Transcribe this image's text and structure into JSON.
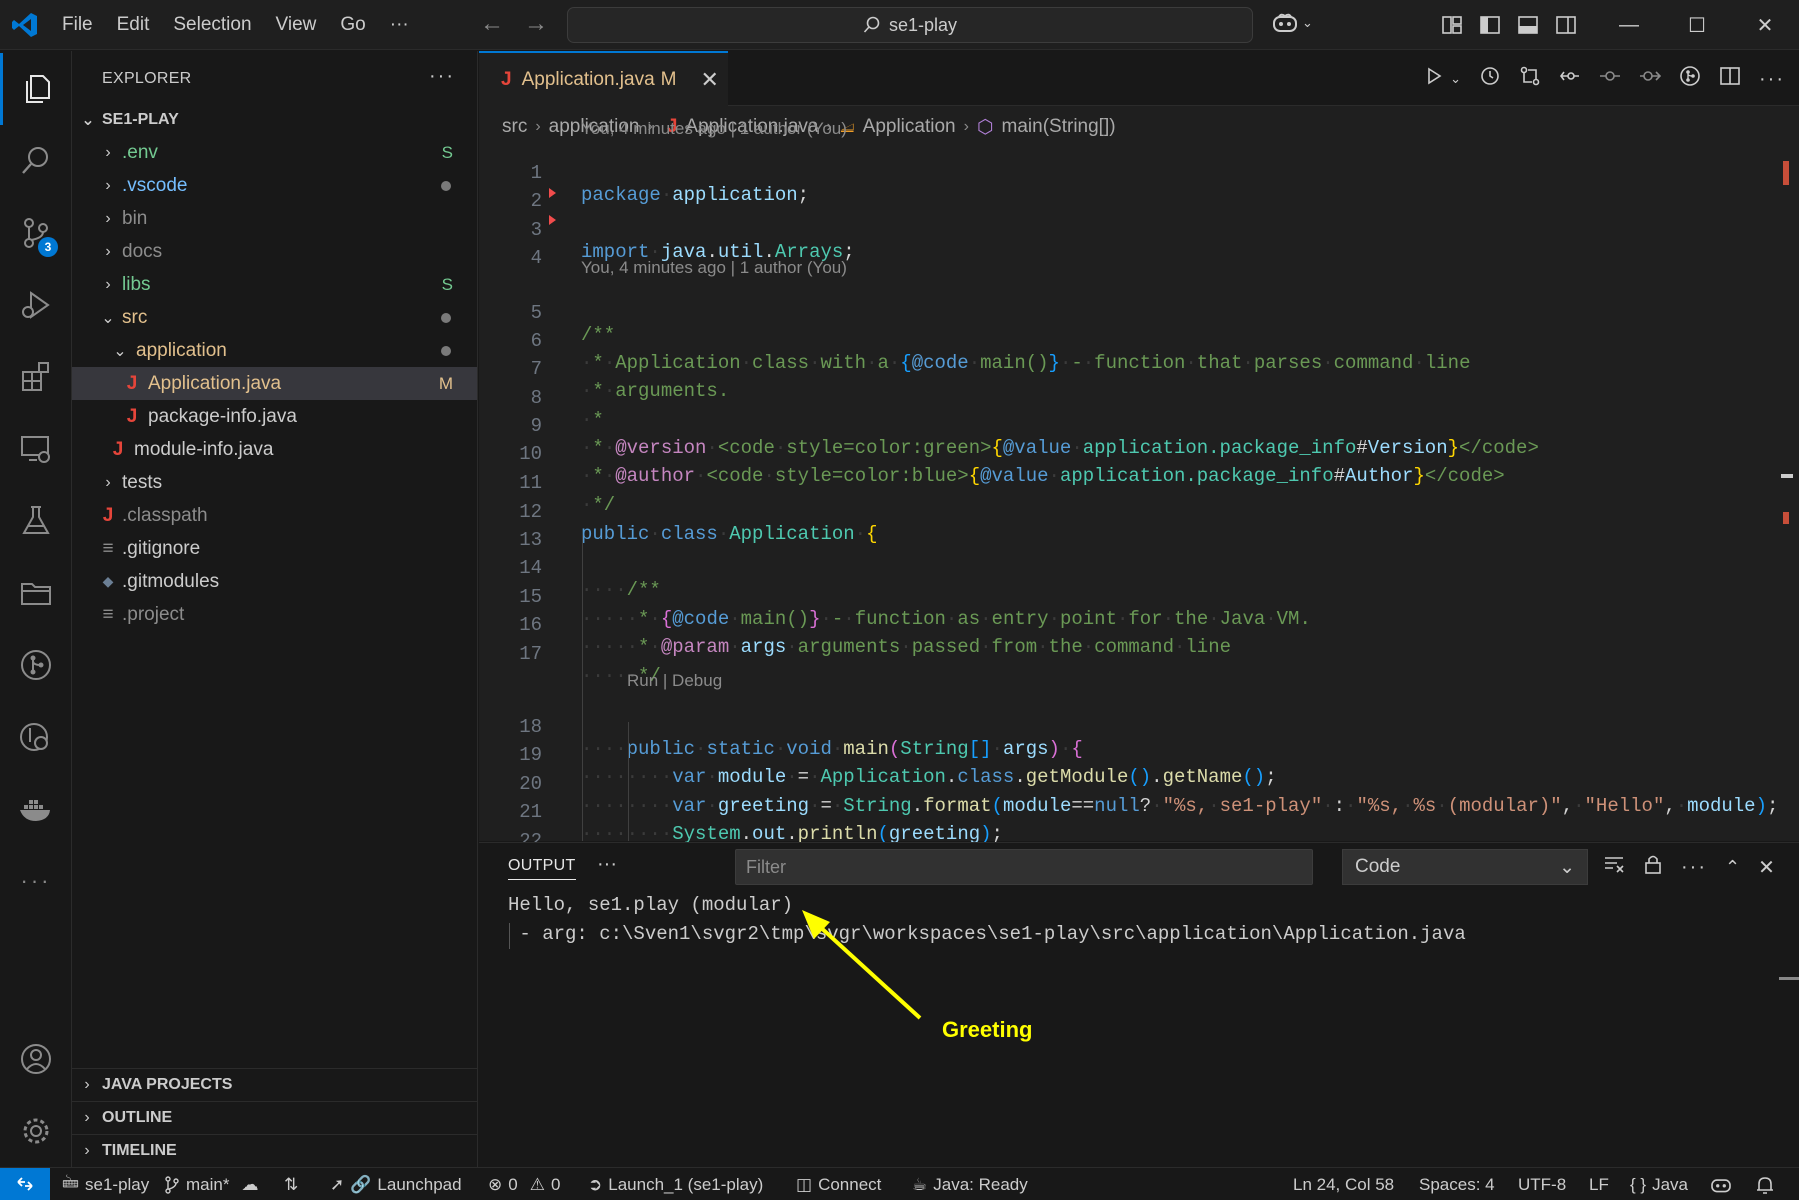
{
  "titlebar": {
    "menu": [
      "File",
      "Edit",
      "Selection",
      "View",
      "Go",
      "···"
    ],
    "search_text": "se1-play"
  },
  "activity": {
    "scm_badge": "3"
  },
  "explorer": {
    "header": "EXPLORER",
    "root": "SE1-PLAY",
    "items": [
      {
        "label": ".env",
        "deco": "S"
      },
      {
        "label": ".vscode",
        "deco": ""
      },
      {
        "label": "bin",
        "deco": ""
      },
      {
        "label": "docs",
        "deco": ""
      },
      {
        "label": "libs",
        "deco": "S"
      },
      {
        "label": "src",
        "deco": ""
      },
      {
        "label": "application",
        "deco": ""
      },
      {
        "label": "Application.java",
        "deco": "M"
      },
      {
        "label": "package-info.java",
        "deco": ""
      },
      {
        "label": "module-info.java",
        "deco": ""
      },
      {
        "label": "tests",
        "deco": ""
      },
      {
        "label": ".classpath",
        "deco": ""
      },
      {
        "label": ".gitignore",
        "deco": ""
      },
      {
        "label": ".gitmodules",
        "deco": ""
      },
      {
        "label": ".project",
        "deco": ""
      }
    ],
    "sections": [
      "JAVA PROJECTS",
      "OUTLINE",
      "TIMELINE"
    ]
  },
  "editor": {
    "tab_label": "Application.java",
    "tab_deco": "M",
    "breadcrumb": [
      "src",
      "application",
      "Application.java",
      "Application",
      "main(String[])"
    ],
    "blame_1": "You, 4 minutes ago | 1 author (You)",
    "blame_2": "You, 4 minutes ago | 1 author (You)",
    "run_debug": "Run | Debug",
    "line_numbers": [
      "1",
      "2",
      "3",
      "4",
      "5",
      "6",
      "7",
      "8",
      "9",
      "10",
      "11",
      "12",
      "13",
      "14",
      "15",
      "16",
      "17",
      "18",
      "19",
      "20",
      "21",
      "22"
    ]
  },
  "panel": {
    "title": "OUTPUT",
    "filter_placeholder": "Filter",
    "channel": "Code",
    "output_line_1": "Hello, se1.play (modular)",
    "output_line_2": " - arg: c:\\Sven1\\svgr2\\tmp\\svgr\\workspaces\\se1-play\\src\\application\\Application.java"
  },
  "annotation": {
    "label": "Greeting",
    "color": "#ffff00"
  },
  "statusbar": {
    "project": "se1-play",
    "branch": "main*",
    "launchpad": "Launchpad",
    "errors": "0",
    "warnings": "0",
    "launch": "Launch_1 (se1-play)",
    "connect": "Connect",
    "java_status": "Java: Ready",
    "position": "Ln 24, Col 58",
    "spaces": "Spaces: 4",
    "encoding": "UTF-8",
    "eol": "LF",
    "language": "Java"
  },
  "colors": {
    "accent": "#0078d4",
    "background": "#1f1f1f"
  }
}
